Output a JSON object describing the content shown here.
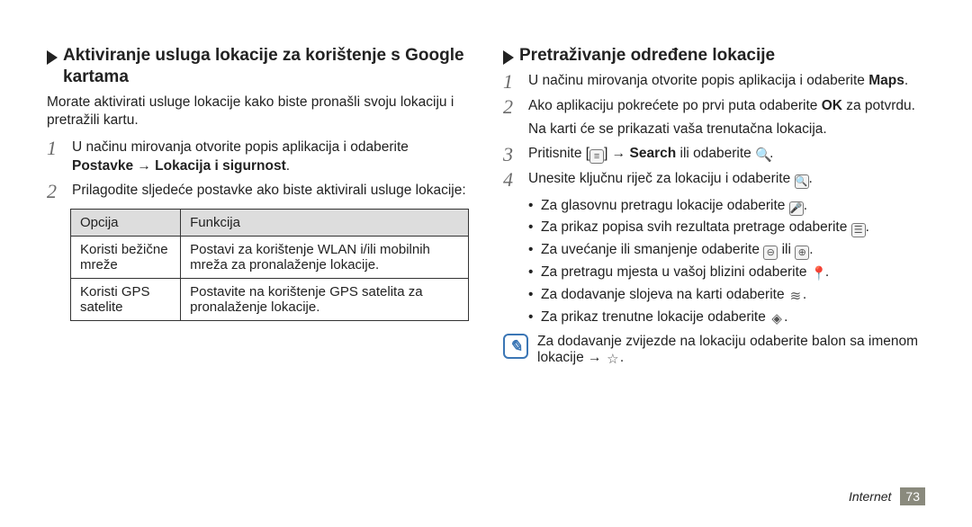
{
  "left": {
    "heading": "Aktiviranje usluga lokacije za korištenje s Google kartama",
    "intro": "Morate aktivirati usluge lokacije kako biste pronašli svoju lokaciju i pretražili kartu.",
    "step1": {
      "num": "1",
      "text_a": "U načinu mirovanja otvorite popis aplikacija i odaberite ",
      "bold": "Postavke → Lokacija i sigurnost",
      "text_b": "."
    },
    "step2": {
      "num": "2",
      "text": "Prilagodite sljedeće postavke ako biste aktivirali usluge lokacije:"
    },
    "table": {
      "h1": "Opcija",
      "h2": "Funkcija",
      "r1c1": "Koristi bežične mreže",
      "r1c2": "Postavi za korištenje WLAN i/ili mobilnih mreža za pronalaženje lokacije.",
      "r2c1": "Koristi GPS satelite",
      "r2c2": "Postavite na korištenje GPS satelita za pronalaženje lokacije."
    }
  },
  "right": {
    "heading": "Pretraživanje određene lokacije",
    "step1": {
      "num": "1",
      "text_a": "U načinu mirovanja otvorite popis aplikacija i odaberite ",
      "bold": "Maps",
      "text_b": "."
    },
    "step2": {
      "num": "2",
      "text_a": "Ako aplikaciju pokrećete po prvi puta odaberite ",
      "bold": "OK",
      "text_b": " za potvrdu."
    },
    "sub": "Na karti će se prikazati vaša trenutačna lokacija.",
    "step3": {
      "num": "3",
      "text_a": "Pritisnite [",
      "icon": "≡",
      "text_b": "] → ",
      "bold": "Search",
      "text_c": " ili odaberite ",
      "icon2": "🔍",
      "text_d": "."
    },
    "step4": {
      "num": "4",
      "text_a": "Unesite ključnu riječ za lokaciju i odaberite ",
      "icon": "🔍",
      "text_b": "."
    },
    "bullets": {
      "b1a": "Za glasovnu pretragu lokacije odaberite ",
      "b1i": "🎤",
      "b2a": "Za prikaz popisa svih rezultata pretrage odaberite ",
      "b2i": "☰",
      "b3a": "Za uvećanje ili smanjenje odaberite ",
      "b3i1": "⊖",
      "b3mid": " ili ",
      "b3i2": "⊕",
      "b4a": "Za pretragu mjesta u vašoj blizini odaberite ",
      "b4i": "📍",
      "b5a": "Za dodavanje slojeva na karti odaberite ",
      "b5i": "≋",
      "b6a": "Za prikaz trenutne lokacije odaberite ",
      "b6i": "◈"
    },
    "note": {
      "text_a": "Za dodavanje zvijezde na lokaciju odaberite balon sa imenom lokacije → ",
      "star": "☆",
      "text_b": "."
    }
  },
  "footer": {
    "section": "Internet",
    "page": "73"
  }
}
